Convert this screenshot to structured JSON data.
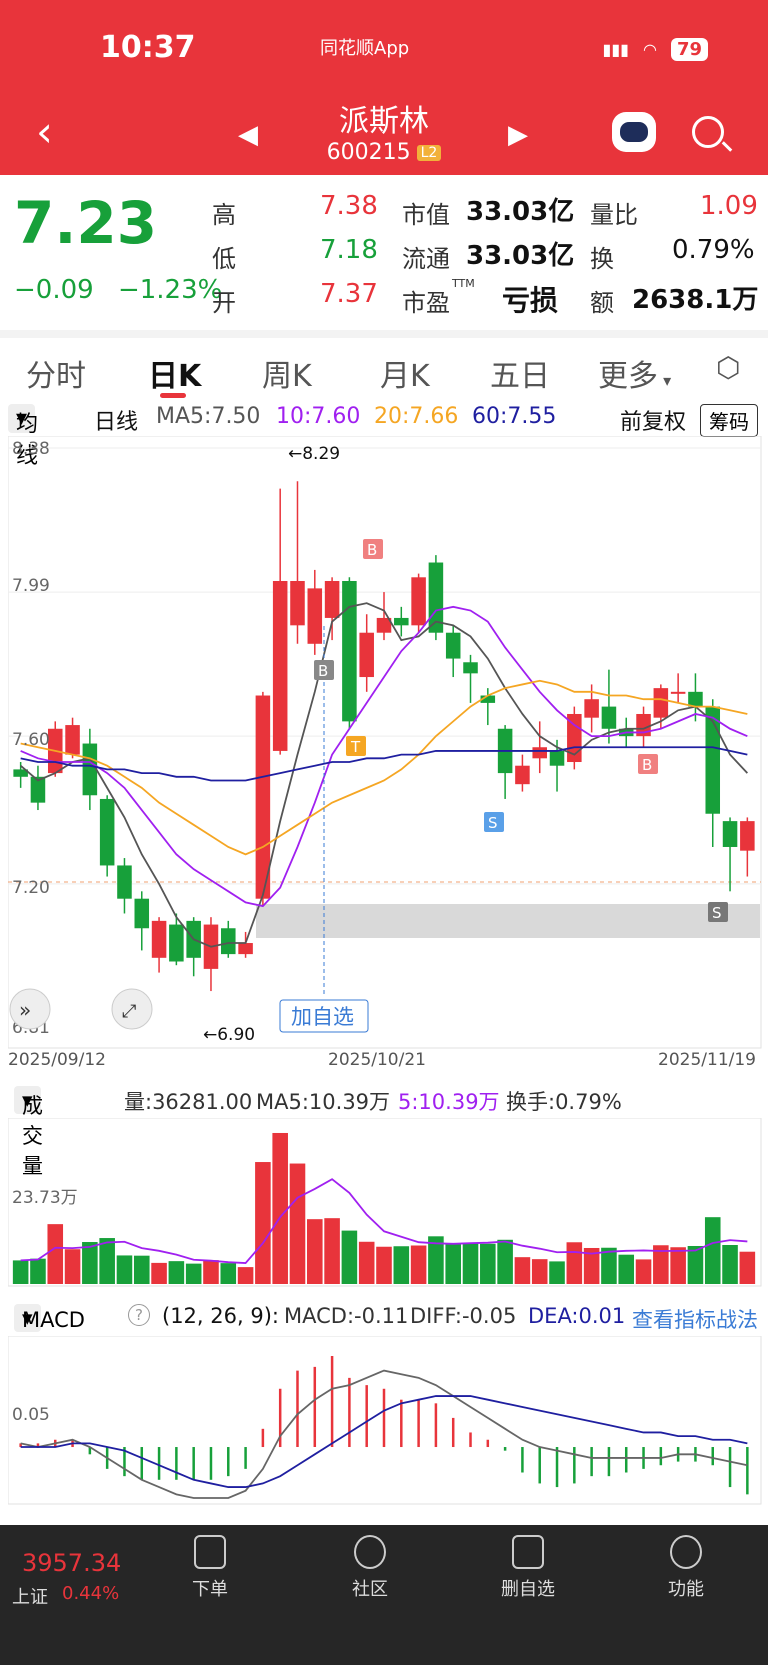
{
  "status": {
    "time": "10:37",
    "app": "同花顺App",
    "battery": "79"
  },
  "header": {
    "name": "派斯林",
    "code": "600215",
    "level": "L2"
  },
  "quote": {
    "price": "7.23",
    "change": "−0.09",
    "change_pct": "−1.23%",
    "high_label": "高",
    "high": "7.38",
    "low_label": "低",
    "low": "7.18",
    "open_label": "开",
    "open": "7.37",
    "mcap_label": "市值",
    "mcap": "33.03亿",
    "float_label": "流通",
    "float": "33.03亿",
    "pe_label": "市盈",
    "pe_sup": "TTM",
    "pe": "亏损",
    "vr_label": "量比",
    "vr": "1.09",
    "turn_label": "换",
    "turn": "0.79%",
    "amt_label": "额",
    "amt": "2638.1万"
  },
  "tabs": [
    "分时",
    "日K",
    "周K",
    "月K",
    "五日",
    "更多"
  ],
  "ma_row": {
    "selector": "均线",
    "period": "日线",
    "ma5": "MA5:7.50",
    "ma10": "10:7.60",
    "ma20": "20:7.66",
    "ma60": "60:7.55",
    "adjust": "前复权",
    "chips": "筹码"
  },
  "kchart": {
    "price_labels": [
      "8.38",
      "7.99",
      "7.60",
      "7.20",
      "6.81"
    ],
    "high_mark": "←8.29",
    "low_mark": "←6.90",
    "dates": [
      "2025/09/12",
      "2025/10/21",
      "2025/11/19"
    ],
    "add_watch": "加自选",
    "signals": [
      "B",
      "B",
      "T",
      "S",
      "B",
      "S"
    ]
  },
  "chart_data": {
    "type": "candlestick",
    "ohlc": [
      [
        7.51,
        7.49,
        7.53,
        7.46
      ],
      [
        7.49,
        7.42,
        7.52,
        7.4
      ],
      [
        7.5,
        7.62,
        7.64,
        7.49
      ],
      [
        7.55,
        7.63,
        7.65,
        7.54
      ],
      [
        7.58,
        7.44,
        7.62,
        7.4
      ],
      [
        7.43,
        7.25,
        7.44,
        7.22
      ],
      [
        7.25,
        7.16,
        7.27,
        7.12
      ],
      [
        7.16,
        7.08,
        7.18,
        7.02
      ],
      [
        7.0,
        7.1,
        7.11,
        6.96
      ],
      [
        7.09,
        6.99,
        7.12,
        6.98
      ],
      [
        7.1,
        7.0,
        7.11,
        6.95
      ],
      [
        6.97,
        7.09,
        7.11,
        6.91
      ],
      [
        7.08,
        7.01,
        7.1,
        7.0
      ],
      [
        7.01,
        7.04,
        7.07,
        7.0
      ],
      [
        7.16,
        7.71,
        7.72,
        7.14
      ],
      [
        7.56,
        8.02,
        8.27,
        7.55
      ],
      [
        7.9,
        8.02,
        8.29,
        7.85
      ],
      [
        7.85,
        8.0,
        8.05,
        7.82
      ],
      [
        7.92,
        8.02,
        8.03,
        7.86
      ],
      [
        8.02,
        7.64,
        8.03,
        7.62
      ],
      [
        7.76,
        7.88,
        7.93,
        7.72
      ],
      [
        7.88,
        7.92,
        7.99,
        7.86
      ],
      [
        7.92,
        7.9,
        7.95,
        7.87
      ],
      [
        7.9,
        8.03,
        8.04,
        7.88
      ],
      [
        8.07,
        7.88,
        8.09,
        7.86
      ],
      [
        7.88,
        7.81,
        7.9,
        7.76
      ],
      [
        7.8,
        7.77,
        7.82,
        7.69
      ],
      [
        7.71,
        7.69,
        7.73,
        7.63
      ],
      [
        7.62,
        7.5,
        7.63,
        7.43
      ],
      [
        7.47,
        7.52,
        7.55,
        7.45
      ],
      [
        7.54,
        7.57,
        7.64,
        7.5
      ],
      [
        7.56,
        7.52,
        7.59,
        7.45
      ],
      [
        7.53,
        7.66,
        7.68,
        7.51
      ],
      [
        7.65,
        7.7,
        7.74,
        7.61
      ],
      [
        7.68,
        7.62,
        7.78,
        7.58
      ],
      [
        7.62,
        7.6,
        7.65,
        7.57
      ],
      [
        7.6,
        7.66,
        7.68,
        7.57
      ],
      [
        7.65,
        7.73,
        7.74,
        7.62
      ],
      [
        7.72,
        7.72,
        7.77,
        7.69
      ],
      [
        7.72,
        7.68,
        7.77,
        7.64
      ],
      [
        7.68,
        7.39,
        7.7,
        7.3
      ],
      [
        7.37,
        7.3,
        7.38,
        7.18
      ],
      [
        7.29,
        7.37,
        7.38,
        7.22
      ]
    ],
    "ma5": [
      7.52,
      7.48,
      7.5,
      7.53,
      7.54,
      7.46,
      7.38,
      7.28,
      7.2,
      7.11,
      7.05,
      7.03,
      7.04,
      7.04,
      7.17,
      7.37,
      7.55,
      7.72,
      7.91,
      7.95,
      7.96,
      7.94,
      7.86,
      7.87,
      7.91,
      7.9,
      7.87,
      7.81,
      7.73,
      7.66,
      7.6,
      7.57,
      7.55,
      7.59,
      7.61,
      7.62,
      7.62,
      7.64,
      7.67,
      7.68,
      7.64,
      7.55,
      7.5
    ],
    "ma10": [
      7.56,
      7.54,
      7.53,
      7.53,
      7.53,
      7.5,
      7.46,
      7.4,
      7.34,
      7.28,
      7.24,
      7.21,
      7.18,
      7.15,
      7.14,
      7.19,
      7.3,
      7.42,
      7.55,
      7.62,
      7.69,
      7.76,
      7.83,
      7.88,
      7.94,
      7.95,
      7.94,
      7.91,
      7.84,
      7.78,
      7.72,
      7.67,
      7.63,
      7.6,
      7.6,
      7.61,
      7.61,
      7.62,
      7.64,
      7.66,
      7.65,
      7.62,
      7.6
    ],
    "ma20": [
      7.58,
      7.57,
      7.56,
      7.55,
      7.54,
      7.52,
      7.49,
      7.46,
      7.42,
      7.39,
      7.36,
      7.33,
      7.3,
      7.28,
      7.3,
      7.33,
      7.36,
      7.39,
      7.42,
      7.44,
      7.46,
      7.48,
      7.51,
      7.55,
      7.6,
      7.64,
      7.68,
      7.71,
      7.73,
      7.74,
      7.75,
      7.74,
      7.72,
      7.72,
      7.71,
      7.71,
      7.7,
      7.7,
      7.69,
      7.68,
      7.68,
      7.67,
      7.66
    ],
    "ma60": [
      7.54,
      7.53,
      7.53,
      7.52,
      7.52,
      7.51,
      7.51,
      7.5,
      7.5,
      7.49,
      7.49,
      7.48,
      7.48,
      7.48,
      7.49,
      7.5,
      7.51,
      7.52,
      7.53,
      7.53,
      7.54,
      7.54,
      7.55,
      7.55,
      7.56,
      7.56,
      7.56,
      7.56,
      7.56,
      7.56,
      7.56,
      7.56,
      7.57,
      7.57,
      7.57,
      7.57,
      7.57,
      7.57,
      7.57,
      7.57,
      7.57,
      7.56,
      7.55
    ],
    "volume": [
      9.5,
      10.2,
      24.1,
      14.0,
      16.9,
      18.5,
      11.5,
      11.4,
      8.5,
      9.2,
      8.2,
      9.6,
      8.4,
      6.8,
      49.1,
      60.8,
      48.5,
      26.1,
      26.5,
      21.5,
      17.0,
      15.0,
      15.2,
      15.5,
      19.2,
      16.0,
      16.3,
      16.2,
      17.8,
      10.8,
      10.0,
      9.1,
      16.8,
      14.5,
      14.6,
      11.8,
      9.9,
      15.6,
      14.8,
      15.3,
      26.9,
      15.7,
      13.0
    ],
    "volume_unit": "万",
    "macd_hist": [
      0.01,
      0.01,
      0.02,
      0.02,
      -0.02,
      -0.06,
      -0.08,
      -0.09,
      -0.09,
      -0.09,
      -0.09,
      -0.09,
      -0.08,
      -0.06,
      0.05,
      0.16,
      0.21,
      0.22,
      0.25,
      0.19,
      0.17,
      0.16,
      0.13,
      0.13,
      0.12,
      0.08,
      0.04,
      0.02,
      -0.01,
      -0.07,
      -0.1,
      -0.11,
      -0.1,
      -0.08,
      -0.08,
      -0.07,
      -0.06,
      -0.05,
      -0.04,
      -0.04,
      -0.05,
      -0.11,
      -0.13
    ],
    "dif": [
      0.01,
      0.0,
      0.01,
      0.02,
      0.0,
      -0.03,
      -0.06,
      -0.09,
      -0.11,
      -0.13,
      -0.14,
      -0.14,
      -0.14,
      -0.12,
      -0.06,
      0.03,
      0.09,
      0.13,
      0.16,
      0.17,
      0.19,
      0.21,
      0.2,
      0.19,
      0.17,
      0.14,
      0.11,
      0.08,
      0.05,
      0.02,
      0.0,
      -0.01,
      -0.02,
      -0.03,
      -0.03,
      -0.03,
      -0.03,
      -0.03,
      -0.02,
      -0.02,
      -0.03,
      -0.04,
      -0.05
    ],
    "dea": [
      0.0,
      0.0,
      0.0,
      0.01,
      0.01,
      0.0,
      -0.01,
      -0.03,
      -0.05,
      -0.07,
      -0.09,
      -0.1,
      -0.11,
      -0.11,
      -0.1,
      -0.08,
      -0.05,
      -0.02,
      0.01,
      0.04,
      0.07,
      0.1,
      0.12,
      0.13,
      0.14,
      0.14,
      0.14,
      0.13,
      0.12,
      0.11,
      0.1,
      0.09,
      0.08,
      0.07,
      0.06,
      0.05,
      0.04,
      0.04,
      0.03,
      0.03,
      0.02,
      0.02,
      0.01
    ]
  },
  "volume_row": {
    "selector": "成交量",
    "vol": "量:36281.00",
    "ma5": "MA5:10.39万",
    "ma5b": "5:10.39万",
    "turn": "换手:0.79%",
    "axis": "23.73万"
  },
  "macd_row": {
    "selector": "MACD",
    "help": "?",
    "params": "(12, 26, 9):",
    "macd": "MACD:-0.11",
    "diff": "DIFF:-0.05",
    "dea": "DEA:0.01",
    "link": "查看指标战法",
    "axis": "0.05"
  },
  "bottombar": {
    "index_val": "3957.34",
    "index_name": "上证",
    "index_chg": "0.44%",
    "items": [
      "下单",
      "社区",
      "删自选",
      "功能"
    ]
  },
  "colors": {
    "up": "#e8343b",
    "down": "#17a03a",
    "ma5": "#555555",
    "ma10": "#a020f0",
    "ma20": "#f5a623",
    "ma60": "#1f1fa0"
  }
}
